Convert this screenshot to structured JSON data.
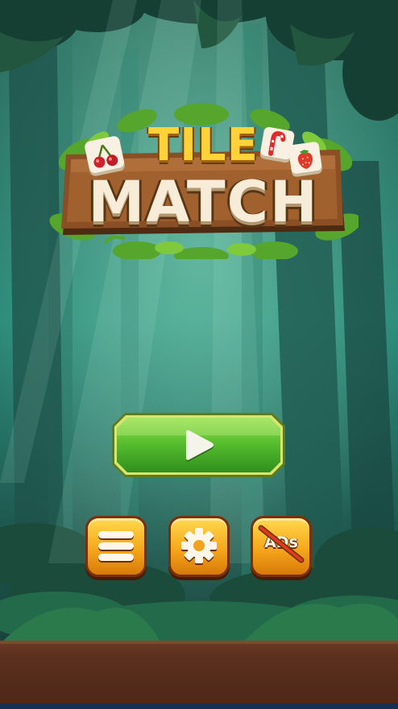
{
  "game": {
    "title_top": "TILE",
    "title_bottom": "MATCH"
  },
  "buttons": {
    "play_icon": "play-icon",
    "menu_icon": "menu-icon",
    "settings_icon": "gear-icon",
    "no_ads_label": "ADs",
    "no_ads_icon": "no-ads-icon"
  },
  "tiles": [
    "cherry-icon",
    "candy-cane-icon",
    "strawberry-icon"
  ],
  "colors": {
    "play_green": "#4cb52d",
    "button_orange": "#f6a71b",
    "title_yellow": "#ffd23a",
    "wood_brown": "#7a4420"
  }
}
